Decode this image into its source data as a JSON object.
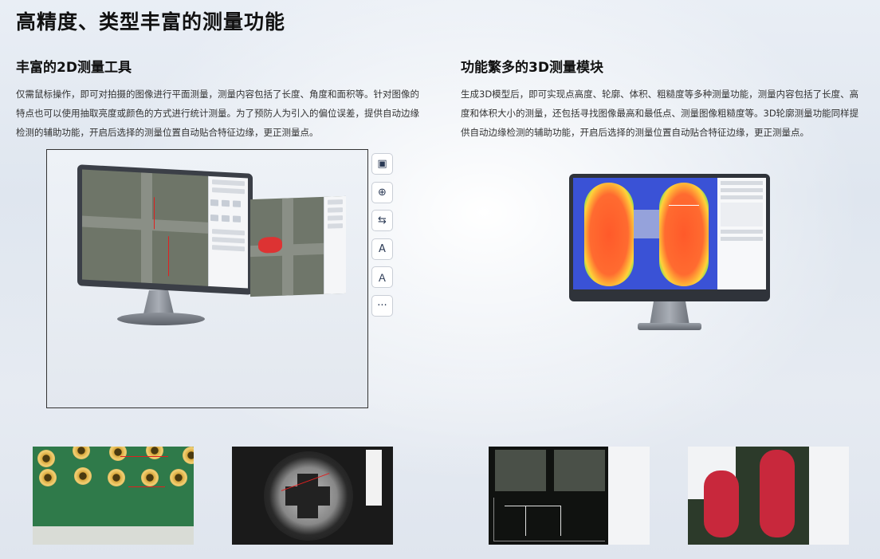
{
  "page": {
    "title": "高精度、类型丰富的测量功能"
  },
  "left": {
    "title": "丰富的2D测量工具",
    "desc": "仅需鼠标操作，即可对拍摄的图像进行平面测量，测量内容包括了长度、角度和面积等。针对图像的特点也可以使用抽取亮度或颜色的方式进行统计测量。为了预防人为引入的偏位误差，提供自动边缘检测的辅助功能，开启后选择的测量位置自动贴合特征边缘，更正测量点。"
  },
  "right": {
    "title": "功能繁多的3D测量模块",
    "desc": "生成3D模型后，即可实现点高度、轮廓、体积、粗糙度等多种测量功能，测量内容包括了长度、高度和体积大小的测量，还包括寻找图像最高和最低点、测量图像粗糙度等。3D轮廓测量功能同样提供自动边缘检测的辅助功能，开启后选择的测量位置自动贴合特征边缘，更正测量点。"
  },
  "toolbar": {
    "tools": [
      {
        "icon": "image-measure-icon",
        "glyph": "▣"
      },
      {
        "icon": "zoom-in-icon",
        "glyph": "⊕"
      },
      {
        "icon": "compare-icon",
        "glyph": "⇆"
      },
      {
        "icon": "text-annotate-icon",
        "glyph": "A"
      },
      {
        "icon": "text-select-icon",
        "glyph": "Ａ"
      },
      {
        "icon": "more-icon",
        "glyph": "···"
      }
    ]
  },
  "colors": {
    "heat_background": "#3a52d6",
    "heat_peak": "#ff5a2a",
    "measure_red": "#e02020",
    "pcb_green": "#2f7a4a"
  }
}
